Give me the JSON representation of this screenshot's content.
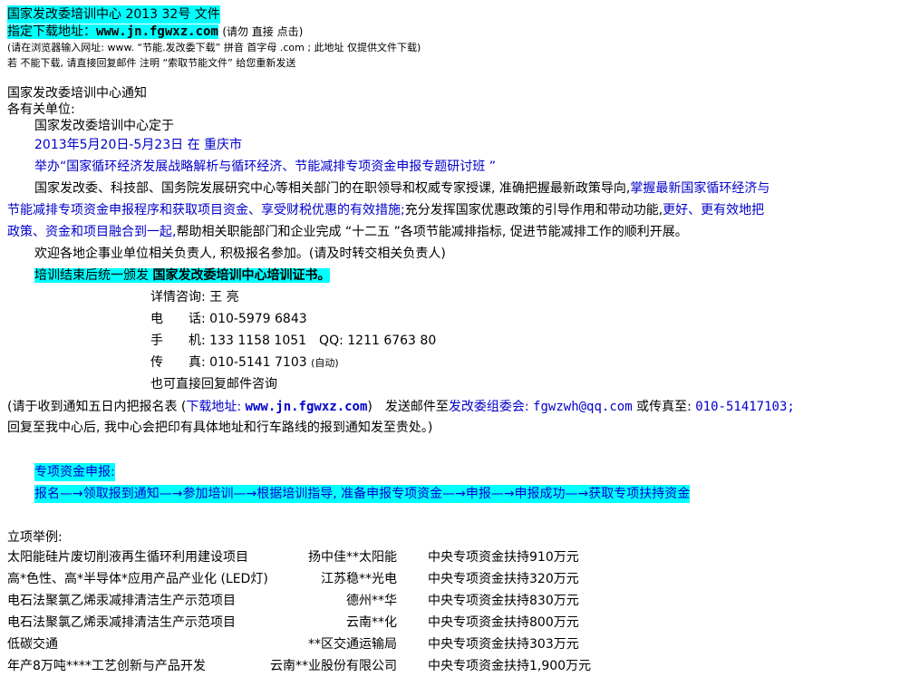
{
  "header": {
    "title": "国家发改委培训中心 2013 32号 文件",
    "download_label": "指定下载地址：",
    "download_url": "www.jn.fgwxz.com",
    "download_note": "(请勿 直接 点击)",
    "browser_hint": "(请在浏览器输入网址: www. “节能.发改委下载” 拼音 首字母 .com ; 此地址 仅提供文件下载)",
    "fallback_hint": "若 不能下载, 请直接回复邮件 注明 “索取节能文件” 给您重新发送"
  },
  "notice": {
    "title": "国家发改委培训中心通知",
    "salutation": "各有关单位:",
    "intro": "国家发改委培训中心定于",
    "date_place": "2013年5月20日-5月23日 在 重庆市",
    "event": "举办“国家循环经济发展战略解析与循环经济、节能减排专项资金申报专题研讨班 ”",
    "para_a1": "国家发改委、科技部、国务院发展研究中心等相关部门的在职领导和权威专家授课, 准确把握最新政策导向,",
    "para_a2": "掌握最新国家循环经济与",
    "para_b1": "节能减排专项资金申报程序和获取项目资金、享受财税优惠的有效措施;",
    "para_b2": "充分发挥国家优惠政策的引导作用和带动功能,",
    "para_b3": "更好、更有效地把",
    "para_c1": "政策、资金和项目融合到一起,",
    "para_c2": "帮助相关职能部门和企业完成 “十二五 ”各项节能减排指标, 促进节能减排工作的顺利开展。",
    "welcome": "欢迎各地企事业单位相关负责人, 积极报名参加。(请及时转交相关负责人)",
    "cert_prefix": "培训结束后统一颁发",
    "cert_name": "国家发改委培训中心培训证书。"
  },
  "contact": {
    "consult": "详情咨询: 王 亮",
    "phone": "电　　话: 010-5979 6843",
    "mobile": "手　　机: 133 1158 1051　QQ: 1211 6763 80",
    "fax": "传　　真: 010-5141 7103",
    "fax_note": "(自动)",
    "email_reply": "也可直接回复邮件咨询"
  },
  "registration": {
    "line1_a": "(请于收到通知五日内把报名表 (",
    "line1_b": "下载地址: ",
    "line1_url": "www.jn.fgwxz.com",
    "line1_c": ")　发送邮件至",
    "line1_d": "发改委组委会: ",
    "line1_email": "fgwzwh@qq.com",
    "line1_e": " 或传真至: ",
    "line1_fax": "010-51417103;",
    "line2": "回复至我中心后, 我中心会把印有具体地址和行车路线的报到通知发至贵处。)"
  },
  "funding": {
    "title": "专项资金申报:",
    "flow": "报名—→领取报到通知—→参加培训—→根据培训指导, 准备申报专项资金—→申报—→申报成功—→获取专项扶持资金"
  },
  "examples": {
    "title": "立项举例:",
    "rows": [
      {
        "project": "太阳能硅片废切削液再生循环利用建设项目",
        "company": "扬中佳**太阳能",
        "support": "中央专项资金扶持910万元"
      },
      {
        "project": "高*色性、高*半导体*应用产品产业化 (LED灯)",
        "company": "江苏稳**光电",
        "support": "中央专项资金扶持320万元"
      },
      {
        "project": "电石法聚氯乙烯汞减排清洁生产示范项目",
        "company": "德州**华",
        "support": "中央专项资金扶持830万元"
      },
      {
        "project": "电石法聚氯乙烯汞减排清洁生产示范项目",
        "company": "云南**化",
        "support": "中央专项资金扶持800万元"
      },
      {
        "project": "低碳交通",
        "company": "**区交通运输局",
        "support": "中央专项资金扶持303万元"
      },
      {
        "project": "年产8万吨****工艺创新与产品开发",
        "company": "云南**业股份有限公司",
        "support": "中央专项资金扶持1,900万元"
      }
    ]
  }
}
